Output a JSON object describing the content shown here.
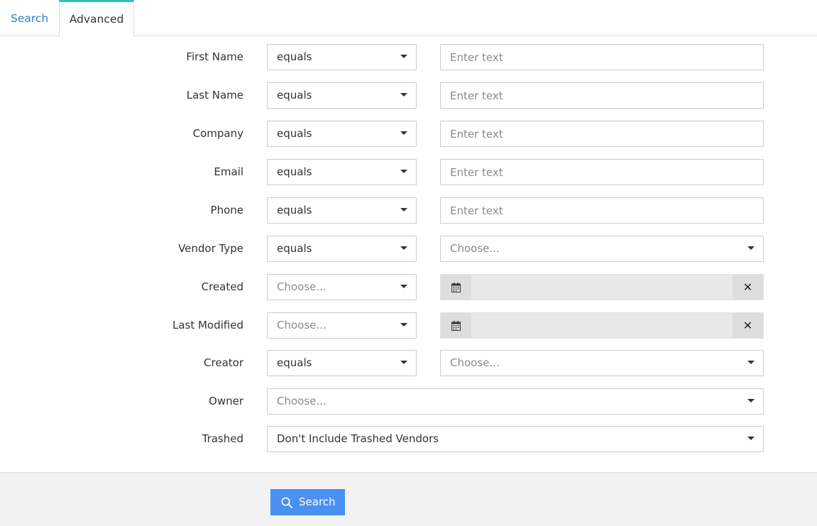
{
  "tabs": [
    {
      "label": "Search",
      "active": false
    },
    {
      "label": "Advanced",
      "active": true
    }
  ],
  "form": {
    "first_name": {
      "label": "First Name",
      "operator": "equals",
      "placeholder": "Enter text"
    },
    "last_name": {
      "label": "Last Name",
      "operator": "equals",
      "placeholder": "Enter text"
    },
    "company": {
      "label": "Company",
      "operator": "equals",
      "placeholder": "Enter text"
    },
    "email": {
      "label": "Email",
      "operator": "equals",
      "placeholder": "Enter text"
    },
    "phone": {
      "label": "Phone",
      "operator": "equals",
      "placeholder": "Enter text"
    },
    "vendor_type": {
      "label": "Vendor Type",
      "operator": "equals",
      "value_placeholder": "Choose..."
    },
    "created": {
      "label": "Created",
      "operator_placeholder": "Choose...",
      "clear_symbol": "✕"
    },
    "last_modified": {
      "label": "Last Modified",
      "operator_placeholder": "Choose...",
      "clear_symbol": "✕"
    },
    "creator": {
      "label": "Creator",
      "operator": "equals",
      "value_placeholder": "Choose..."
    },
    "owner": {
      "label": "Owner",
      "placeholder": "Choose..."
    },
    "trashed": {
      "label": "Trashed",
      "value": "Don't Include Trashed Vendors"
    }
  },
  "footer": {
    "search_button_label": "Search"
  },
  "colors": {
    "tab_link": "#2f7fc1",
    "tab_active_border": "#35c0b5",
    "button_primary": "#4a90f2",
    "footer_bg": "#f2f2f2"
  },
  "icons": {
    "calendar": "calendar-icon",
    "clear": "close-icon",
    "dropdown": "caret-down-icon",
    "search": "search-icon"
  }
}
